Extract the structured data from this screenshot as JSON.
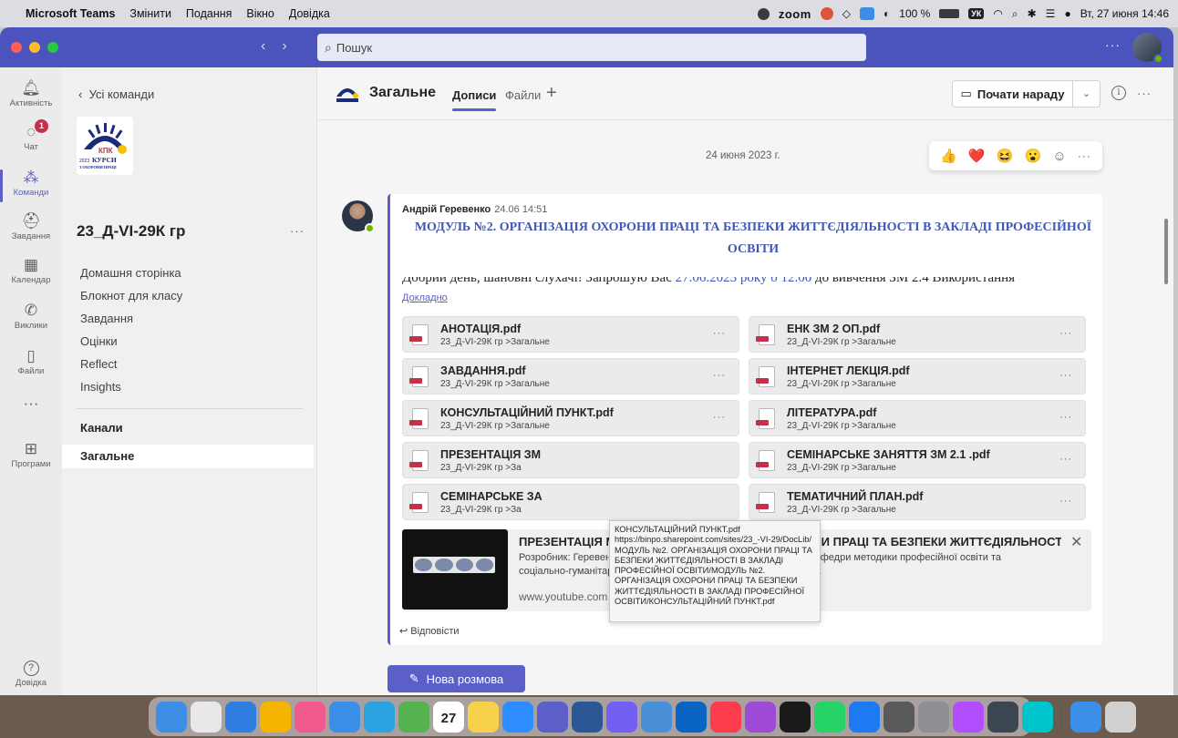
{
  "menubar": {
    "app_name": "Microsoft Teams",
    "menus": [
      "Змінити",
      "Подання",
      "Вікно",
      "Довідка"
    ],
    "zoom_label": "zoom",
    "battery": "100 %",
    "keyboard": "УК",
    "datetime": "Вт, 27 июня 14:46"
  },
  "titlebar": {
    "search_placeholder": "Пошук",
    "more": "···"
  },
  "rail": [
    {
      "label": "Активність",
      "icon": "bell-icon"
    },
    {
      "label": "Чат",
      "icon": "chat-icon",
      "badge": "1"
    },
    {
      "label": "Команди",
      "icon": "teams-icon",
      "active": true
    },
    {
      "label": "Завдання",
      "icon": "assignments-icon"
    },
    {
      "label": "Календар",
      "icon": "calendar-icon"
    },
    {
      "label": "Виклики",
      "icon": "phone-icon"
    },
    {
      "label": "Файли",
      "icon": "file-icon"
    },
    {
      "label": "···",
      "icon": "more-icon"
    },
    {
      "label": "Програми",
      "icon": "apps-icon"
    },
    {
      "label": "Довідка",
      "icon": "help-icon"
    }
  ],
  "sidebar": {
    "back": "Усі команди",
    "team_name": "23_Д-VI-29К гр",
    "logo_text": "КПК",
    "logo_sub": "КУРСИ",
    "logo_sub2": "З ОХОРОНИ ПРАЦІ",
    "logo_year": "2023",
    "links": [
      "Домашня сторінка",
      "Блокнот для класу",
      "Завдання",
      "Оцінки",
      "Reflect",
      "Insights"
    ],
    "channels_header": "Канали",
    "channel": "Загальне"
  },
  "channel_header": {
    "title": "Загальне",
    "tabs": [
      "Дописи",
      "Файли"
    ],
    "meet_button": "Почати нараду"
  },
  "feed": {
    "date": "24 июня 2023 г.",
    "reactions": [
      "👍",
      "❤️",
      "😆",
      "😮",
      "☺"
    ],
    "message": {
      "author": "Андрій Геревенко",
      "time": "24.06 14:51",
      "subject": "МОДУЛЬ №2. ОРГАНІЗАЦІЯ ОХОРОНИ ПРАЦІ ТА БЕЗПЕКИ ЖИТТЄДІЯЛЬНОСТІ В ЗАКЛАДІ ПРОФЕСІЙНОЇ ОСВІТИ",
      "preview_a": "Добрий день, шановні слухачі! Запрошую Вас ",
      "preview_b": "27.06.2023 року о 12.00",
      "preview_c": " до вивчення ЗМ 2.4 Використання",
      "details": "Докладно",
      "files": [
        {
          "name": "АНОТАЦІЯ.pdf",
          "path": "23_Д-VI-29К гр >Загальне"
        },
        {
          "name": "ЕНК ЗМ 2 ОП.pdf",
          "path": "23_Д-VI-29К гр >Загальне"
        },
        {
          "name": "ЗАВДАННЯ.pdf",
          "path": "23_Д-VI-29К гр >Загальне"
        },
        {
          "name": "ІНТЕРНЕТ ЛЕКЦІЯ.pdf",
          "path": "23_Д-VI-29К гр >Загальне"
        },
        {
          "name": "КОНСУЛЬТАЦІЙНИЙ ПУНКТ.pdf",
          "path": "23_Д-VI-29К гр >Загальне"
        },
        {
          "name": "ЛІТЕРАТУРА.pdf",
          "path": "23_Д-VI-29К гр >Загальне"
        },
        {
          "name": "ПРЕЗЕНТАЦІЯ ЗМ",
          "path": "23_Д-VI-29К гр >За"
        },
        {
          "name": "СЕМІНАРСЬКЕ ЗАНЯТТЯ ЗМ 2.1 .pdf",
          "path": "23_Д-VI-29К гр >Загальне"
        },
        {
          "name": "СЕМІНАРСЬКЕ ЗА",
          "path": "23_Д-VI-29К гр >За"
        },
        {
          "name": "ТЕМАТИЧНИЙ ПЛАН.pdf",
          "path": "23_Д-VI-29К гр >Загальне"
        }
      ],
      "tooltip": "КОНСУЛЬТАЦІЙНИЙ ПУНКТ.pdf https://binpo.sharepoint.com/sites/23_-VI-29/DocLib/МОДУЛЬ №2. ОРГАНІЗАЦІЯ ОХОРОНИ ПРАЦІ ТА БЕЗПЕКИ ЖИТТЄДІЯЛЬНОСТІ В ЗАКЛАДІ ПРОФЕСІЙНОЇ ОСВІТИ/МОДУЛЬ №2. ОРГАНІЗАЦІЯ ОХОРОНИ ПРАЦІ ТА БЕЗПЕКИ ЖИТТЄДІЯЛЬНОСТІ В ЗАКЛАДІ ПРОФЕСІЙНОЇ ОСВІТИ/КОНСУЛЬТАЦІЙНИЙ ПУНКТ.pdf",
      "link_preview": {
        "title": "ПРЕЗЕНТАЦІЯ МОДУЛЬ №2. ОРГАНІЗАЦІЯ ОХОРОНИ ПРАЦІ ТА БЕЗПЕКИ ЖИТТЄДІЯЛЬНОСТІ В ЗАКЛ...",
        "description": "Розробник: Геревенко Андрій Михайлович, старший викладач кафедри методики професійної освіти та соціально-гуманітарних дисциплін Білоцерківського інституту н...",
        "site": "www.youtube.com"
      },
      "reply": "Відповісти"
    },
    "new_conversation": "Нова розмова"
  },
  "dock": {
    "calendar_day": "27",
    "icons": [
      "finder-icon",
      "launchpad-icon",
      "safari-icon",
      "chrome-icon",
      "photos-icon",
      "mail-icon",
      "telegram-icon",
      "maps-icon",
      "calendar-icon",
      "notes-icon",
      "zoom-icon",
      "teams-icon",
      "word-icon",
      "viber-icon",
      "mission-icon",
      "outlook-icon",
      "music-icon",
      "podcast-icon",
      "vpn-icon",
      "whatsapp-icon",
      "appstore-icon",
      "calculator-icon",
      "settings-icon",
      "messenger-icon",
      "screen-icon",
      "canva-icon",
      "downloads-icon",
      "trash-icon"
    ]
  },
  "colors": {
    "brand": "#5b5fc7",
    "titlebar": "#4b53bc",
    "status_online": "#6bb700",
    "badge": "#c4314b"
  }
}
